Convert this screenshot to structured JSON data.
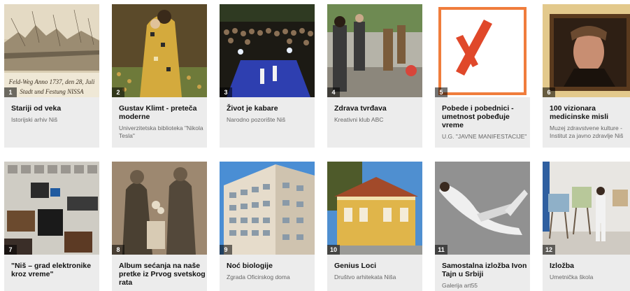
{
  "events": [
    {
      "number": "1",
      "title": "Stariji od veka",
      "organizer": "Istorijski arhiv Niš",
      "image_caption": "Feld-Weg Anno 1737, den 28, Juli ... Stadt und Festung NISSA",
      "image_caption_top": "Feld-Weg Anno 1737, den 28, Juli",
      "image_caption_bottom": "Stadt und Festung NISSA"
    },
    {
      "number": "2",
      "title": "Gustav Klimt - preteča moderne",
      "organizer": "Univerzitetska biblioteka \"Nikola Tesla\""
    },
    {
      "number": "3",
      "title": "Život je kabare",
      "organizer": "Narodno pozorište Niš"
    },
    {
      "number": "4",
      "title": "Zdrava tvrđava",
      "organizer": "Kreativni klub ABC"
    },
    {
      "number": "5",
      "title": "Pobede i pobednici - umetnost pobeđuje vreme",
      "organizer": "U.G. \"JAVNE MANIFESTACIJE\""
    },
    {
      "number": "6",
      "title": "100 vizionara medicinske misli",
      "organizer": "Muzej zdravstvene kulture - Institut za javno zdravlje Niš"
    },
    {
      "number": "7",
      "title": "\"Niš – grad elektronike kroz vreme\"",
      "organizer": ""
    },
    {
      "number": "8",
      "title": "Album sećanja na naše pretke iz Prvog svetskog rata",
      "organizer": ""
    },
    {
      "number": "9",
      "title": "Noć biologije",
      "organizer": "Zgrada Oficirskog doma"
    },
    {
      "number": "10",
      "title": "Genius Loci",
      "organizer": "Društvo arhitekata Niša"
    },
    {
      "number": "11",
      "title": "Samostalna izložba Ivon Tajn u Srbiji",
      "organizer": "Galerija art55"
    },
    {
      "number": "12",
      "title": "Izložba",
      "organizer": "Umetnička škola"
    }
  ]
}
